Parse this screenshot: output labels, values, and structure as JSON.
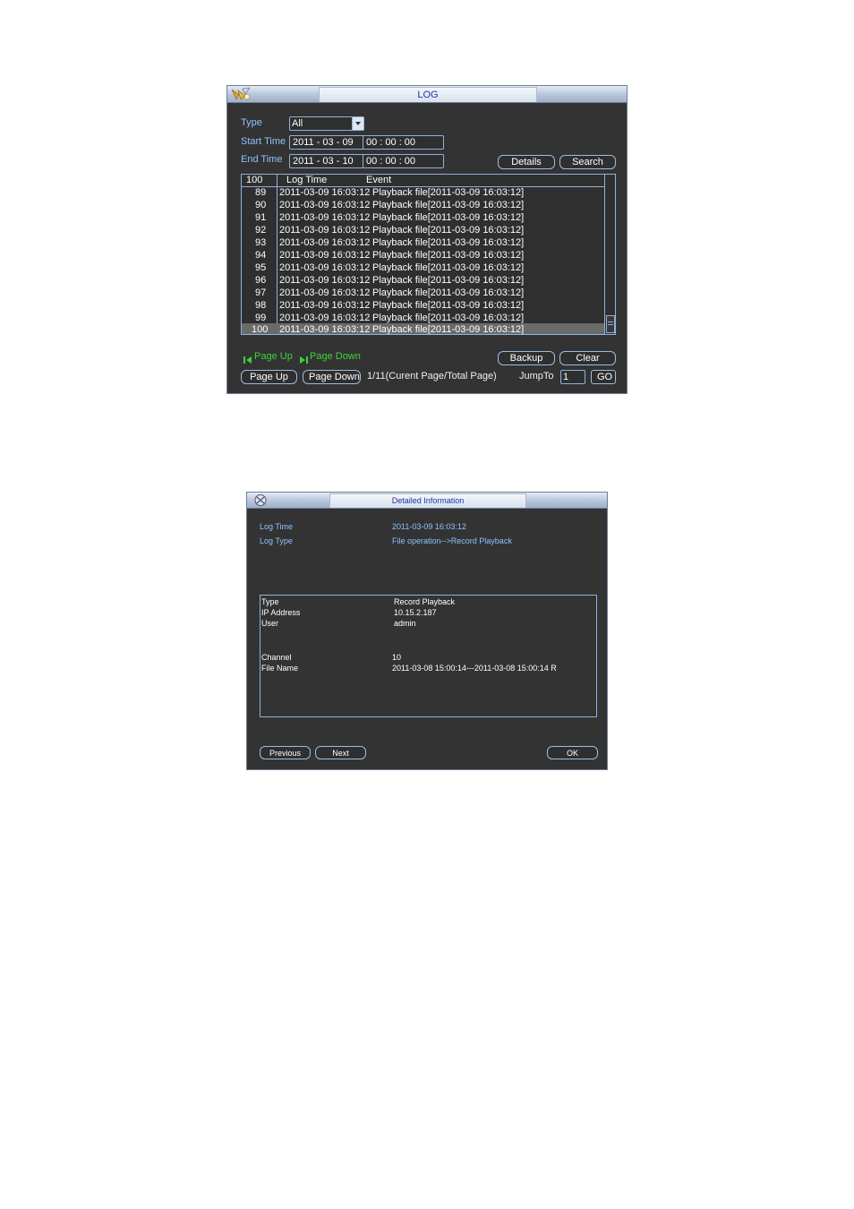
{
  "log_window": {
    "title": "LOG",
    "type_label": "Type",
    "type_value": "All",
    "start_label": "Start Time",
    "start_date": "2011  - 03 - 09",
    "start_time": "00 : 00 : 00",
    "end_label": "End Time",
    "end_date": "2011  - 03 - 10",
    "end_time": "00 : 00 : 00",
    "details_button": "Details",
    "search_button": "Search",
    "columns": [
      "100",
      "Log Time",
      "Event"
    ],
    "rows": [
      {
        "num": "89",
        "time": "2011-03-09 16:03:12",
        "event": "Playback file[2011-03-09 16:03:12]"
      },
      {
        "num": "90",
        "time": "2011-03-09 16:03:12",
        "event": "Playback file[2011-03-09 16:03:12]"
      },
      {
        "num": "91",
        "time": "2011-03-09 16:03:12",
        "event": "Playback file[2011-03-09 16:03:12]"
      },
      {
        "num": "92",
        "time": "2011-03-09 16:03:12",
        "event": "Playback file[2011-03-09 16:03:12]"
      },
      {
        "num": "93",
        "time": "2011-03-09 16:03:12",
        "event": "Playback file[2011-03-09 16:03:12]"
      },
      {
        "num": "94",
        "time": "2011-03-09 16:03:12",
        "event": "Playback file[2011-03-09 16:03:12]"
      },
      {
        "num": "95",
        "time": "2011-03-09 16:03:12",
        "event": "Playback file[2011-03-09 16:03:12]"
      },
      {
        "num": "96",
        "time": "2011-03-09 16:03:12",
        "event": "Playback file[2011-03-09 16:03:12]"
      },
      {
        "num": "97",
        "time": "2011-03-09 16:03:12",
        "event": "Playback file[2011-03-09 16:03:12]"
      },
      {
        "num": "98",
        "time": "2011-03-09 16:03:12",
        "event": "Playback file[2011-03-09 16:03:12]"
      },
      {
        "num": "99",
        "time": "2011-03-09 16:03:12",
        "event": "Playback file[2011-03-09 16:03:12]"
      },
      {
        "num": "100",
        "time": "2011-03-09 16:03:12",
        "event": "Playback file[2011-03-09 16:03:12]"
      }
    ],
    "hint_page_up": "Page Up",
    "hint_page_down": "Page Down",
    "backup_button": "Backup",
    "clear_button": "Clear",
    "page_up_button": "Page Up",
    "page_down_button": "Page Down",
    "page_info": "1/11(Curent Page/Total Page)",
    "jumpto_label": "JumpTo",
    "jumpto_value": "1",
    "go_button": "GO"
  },
  "detail_window": {
    "title": "Detailed Information",
    "log_time_label": "Log Time",
    "log_time_value": "2011-03-09 16:03:12",
    "log_type_label": "Log Type",
    "log_type_value": "File operation-->Record Playback",
    "type_label": "Type",
    "type_value": "Record Playback",
    "ip_label": "IP Address",
    "ip_value": "10.15.2.187",
    "user_label": "User",
    "user_value": "admin",
    "channel_label": "Channel",
    "channel_value": "10",
    "file_label": "File Name",
    "file_value": "2011-03-08 15:00:14---2011-03-08 15:00:14 R",
    "previous_button": "Previous",
    "next_button": "Next",
    "ok_button": "OK"
  },
  "colors": {
    "panel_bg": "#333333",
    "label_blue": "#8cc3ff",
    "border_blue": "#8fb2db",
    "title_text": "#1b35a8",
    "hint_green": "#3ad43a"
  },
  "icons": [
    "log-window-logo-icon",
    "detail-window-logo-icon",
    "dropdown-arrow-icon",
    "first-page-icon",
    "last-page-icon"
  ]
}
